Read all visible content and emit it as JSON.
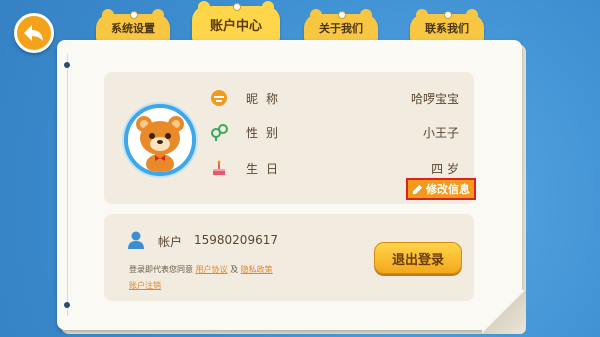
{
  "tabs": [
    {
      "label": "系统设置",
      "active": false
    },
    {
      "label": "账户中心",
      "active": true
    },
    {
      "label": "关于我们",
      "active": false
    },
    {
      "label": "联系我们",
      "active": false
    }
  ],
  "profile": {
    "nickname_label": "昵称",
    "nickname_value": "哈啰宝宝",
    "gender_label": "性别",
    "gender_value": "小王子",
    "birthday_label": "生日",
    "birthday_value": "四 岁",
    "edit_label": "修改信息"
  },
  "account": {
    "label": "帐户",
    "value": "15980209617",
    "agree_text": "登录即代表您同意",
    "user_agreement": "用户协议",
    "and_text": "及",
    "privacy_policy": "隐私政策",
    "deregister": "账户注销",
    "logout_label": "退出登录"
  },
  "colors": {
    "background": "#3d8fd1",
    "tab": "#f7c744",
    "accent_orange": "#f19a1e",
    "highlight_border": "#d8231e"
  },
  "icons": [
    "back-arrow-icon",
    "nickname-icon",
    "gender-icon",
    "birthday-cake-icon",
    "edit-pencil-icon",
    "user-icon"
  ]
}
